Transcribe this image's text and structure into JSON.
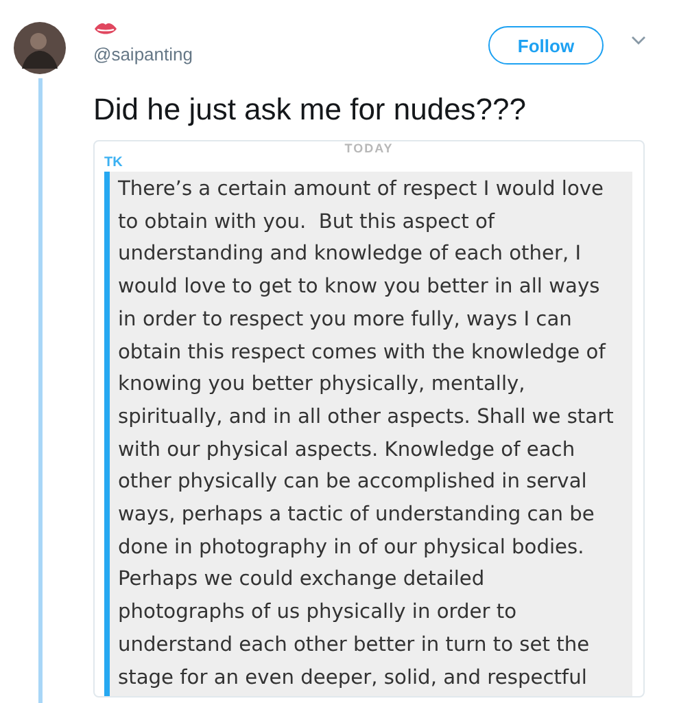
{
  "tweet": {
    "handle": "@saipanting",
    "follow_button": "Follow",
    "text": "Did he just ask me for nudes???"
  },
  "embedded_screenshot": {
    "date_label": "TODAY",
    "sender": "TK",
    "message": "There’s a certain amount of respect I would love\nto obtain with you.  But this aspect of\nunderstanding and knowledge of each other, I\nwould love to get to know you better in all ways\nin order to respect you more fully, ways I can\nobtain this respect comes with the knowledge of\nknowing you better physically, mentally,\nspiritually, and in all other aspects. Shall we start\nwith our physical aspects. Knowledge of each\nother physically can be accomplished in serval\nways, perhaps a tactic of understanding can be\ndone in photography in of our physical bodies.\nPerhaps we could exchange detailed\nphotographs of us physically in order to\nunderstand each other better in turn to set the\nstage for an even deeper, solid, and respectful"
  }
}
